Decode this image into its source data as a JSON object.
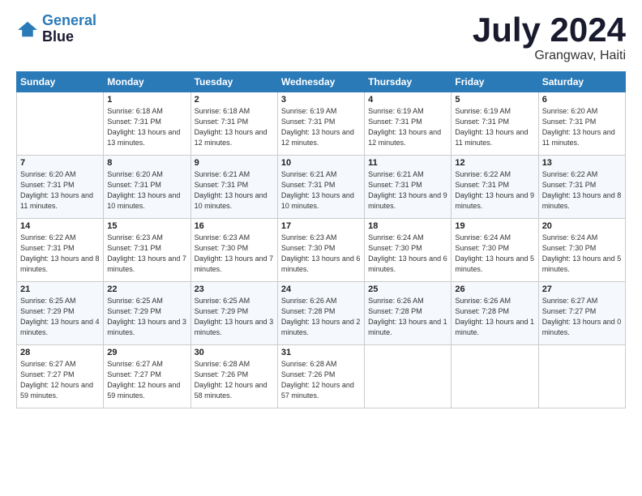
{
  "logo": {
    "line1": "General",
    "line2": "Blue"
  },
  "title": "July 2024",
  "subtitle": "Grangwav, Haiti",
  "days_of_week": [
    "Sunday",
    "Monday",
    "Tuesday",
    "Wednesday",
    "Thursday",
    "Friday",
    "Saturday"
  ],
  "weeks": [
    [
      {
        "day": "",
        "empty": true
      },
      {
        "day": "1",
        "rise": "6:18 AM",
        "set": "7:31 PM",
        "daylight": "13 hours and 13 minutes."
      },
      {
        "day": "2",
        "rise": "6:18 AM",
        "set": "7:31 PM",
        "daylight": "13 hours and 12 minutes."
      },
      {
        "day": "3",
        "rise": "6:19 AM",
        "set": "7:31 PM",
        "daylight": "13 hours and 12 minutes."
      },
      {
        "day": "4",
        "rise": "6:19 AM",
        "set": "7:31 PM",
        "daylight": "13 hours and 12 minutes."
      },
      {
        "day": "5",
        "rise": "6:19 AM",
        "set": "7:31 PM",
        "daylight": "13 hours and 11 minutes."
      },
      {
        "day": "6",
        "rise": "6:20 AM",
        "set": "7:31 PM",
        "daylight": "13 hours and 11 minutes."
      }
    ],
    [
      {
        "day": "7",
        "rise": "6:20 AM",
        "set": "7:31 PM",
        "daylight": "13 hours and 11 minutes."
      },
      {
        "day": "8",
        "rise": "6:20 AM",
        "set": "7:31 PM",
        "daylight": "13 hours and 10 minutes."
      },
      {
        "day": "9",
        "rise": "6:21 AM",
        "set": "7:31 PM",
        "daylight": "13 hours and 10 minutes."
      },
      {
        "day": "10",
        "rise": "6:21 AM",
        "set": "7:31 PM",
        "daylight": "13 hours and 10 minutes."
      },
      {
        "day": "11",
        "rise": "6:21 AM",
        "set": "7:31 PM",
        "daylight": "13 hours and 9 minutes."
      },
      {
        "day": "12",
        "rise": "6:22 AM",
        "set": "7:31 PM",
        "daylight": "13 hours and 9 minutes."
      },
      {
        "day": "13",
        "rise": "6:22 AM",
        "set": "7:31 PM",
        "daylight": "13 hours and 8 minutes."
      }
    ],
    [
      {
        "day": "14",
        "rise": "6:22 AM",
        "set": "7:31 PM",
        "daylight": "13 hours and 8 minutes."
      },
      {
        "day": "15",
        "rise": "6:23 AM",
        "set": "7:31 PM",
        "daylight": "13 hours and 7 minutes."
      },
      {
        "day": "16",
        "rise": "6:23 AM",
        "set": "7:30 PM",
        "daylight": "13 hours and 7 minutes."
      },
      {
        "day": "17",
        "rise": "6:23 AM",
        "set": "7:30 PM",
        "daylight": "13 hours and 6 minutes."
      },
      {
        "day": "18",
        "rise": "6:24 AM",
        "set": "7:30 PM",
        "daylight": "13 hours and 6 minutes."
      },
      {
        "day": "19",
        "rise": "6:24 AM",
        "set": "7:30 PM",
        "daylight": "13 hours and 5 minutes."
      },
      {
        "day": "20",
        "rise": "6:24 AM",
        "set": "7:30 PM",
        "daylight": "13 hours and 5 minutes."
      }
    ],
    [
      {
        "day": "21",
        "rise": "6:25 AM",
        "set": "7:29 PM",
        "daylight": "13 hours and 4 minutes."
      },
      {
        "day": "22",
        "rise": "6:25 AM",
        "set": "7:29 PM",
        "daylight": "13 hours and 3 minutes."
      },
      {
        "day": "23",
        "rise": "6:25 AM",
        "set": "7:29 PM",
        "daylight": "13 hours and 3 minutes."
      },
      {
        "day": "24",
        "rise": "6:26 AM",
        "set": "7:28 PM",
        "daylight": "13 hours and 2 minutes."
      },
      {
        "day": "25",
        "rise": "6:26 AM",
        "set": "7:28 PM",
        "daylight": "13 hours and 1 minute."
      },
      {
        "day": "26",
        "rise": "6:26 AM",
        "set": "7:28 PM",
        "daylight": "13 hours and 1 minute."
      },
      {
        "day": "27",
        "rise": "6:27 AM",
        "set": "7:27 PM",
        "daylight": "13 hours and 0 minutes."
      }
    ],
    [
      {
        "day": "28",
        "rise": "6:27 AM",
        "set": "7:27 PM",
        "daylight": "12 hours and 59 minutes."
      },
      {
        "day": "29",
        "rise": "6:27 AM",
        "set": "7:27 PM",
        "daylight": "12 hours and 59 minutes."
      },
      {
        "day": "30",
        "rise": "6:28 AM",
        "set": "7:26 PM",
        "daylight": "12 hours and 58 minutes."
      },
      {
        "day": "31",
        "rise": "6:28 AM",
        "set": "7:26 PM",
        "daylight": "12 hours and 57 minutes."
      },
      {
        "day": "",
        "empty": true
      },
      {
        "day": "",
        "empty": true
      },
      {
        "day": "",
        "empty": true
      }
    ]
  ]
}
